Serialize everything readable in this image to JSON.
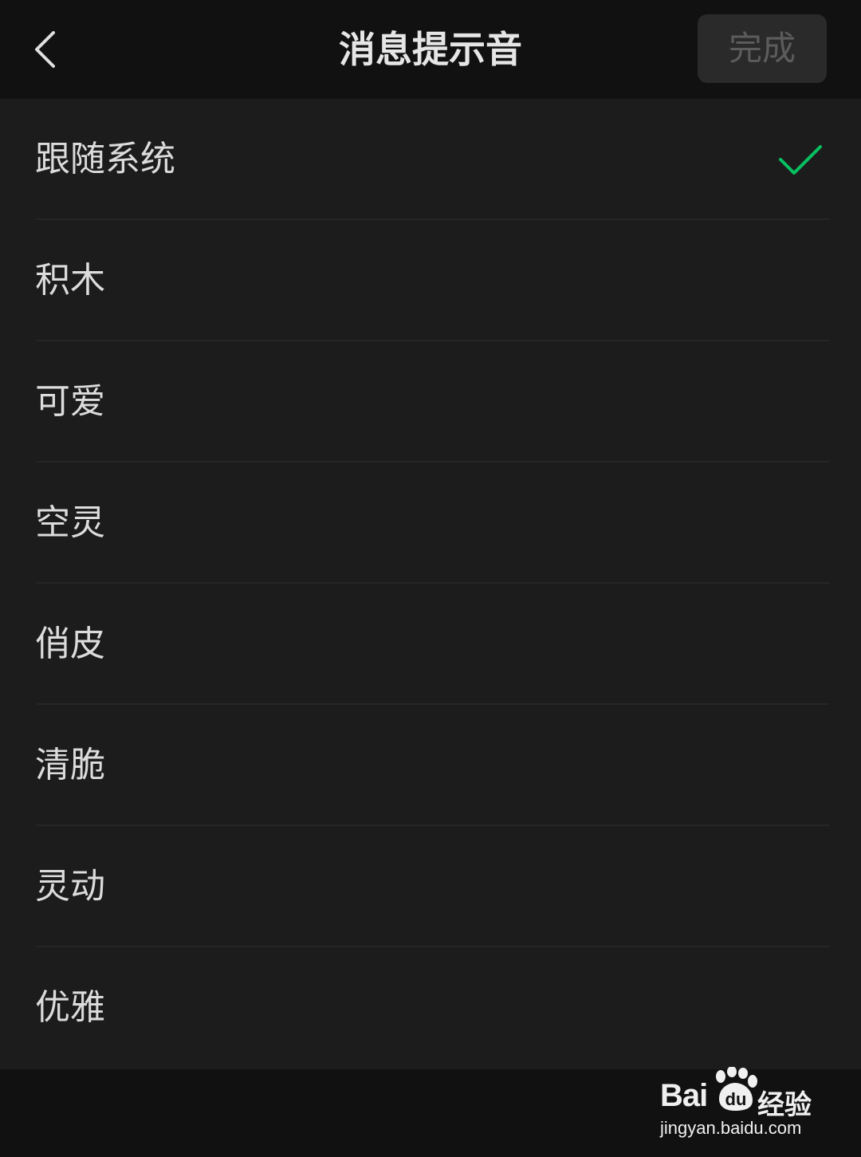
{
  "header": {
    "back_icon": "chevron-left-icon",
    "title": "消息提示音",
    "done_label": "完成"
  },
  "list": {
    "items": [
      {
        "label": "跟随系统",
        "selected": true
      },
      {
        "label": "积木",
        "selected": false
      },
      {
        "label": "可爱",
        "selected": false
      },
      {
        "label": "空灵",
        "selected": false
      },
      {
        "label": "俏皮",
        "selected": false
      },
      {
        "label": "清脆",
        "selected": false
      },
      {
        "label": "灵动",
        "selected": false
      },
      {
        "label": "优雅",
        "selected": false
      }
    ],
    "check_icon": "checkmark-icon",
    "check_color": "#07c160"
  },
  "watermark": {
    "brand": "Bai",
    "brand_suffix": "经验",
    "paw_text": "du",
    "url": "jingyan.baidu.com"
  },
  "colors": {
    "background": "#111111",
    "list_background": "#1c1c1c",
    "done_button_bg": "#2a2a2a",
    "accent": "#07c160"
  }
}
